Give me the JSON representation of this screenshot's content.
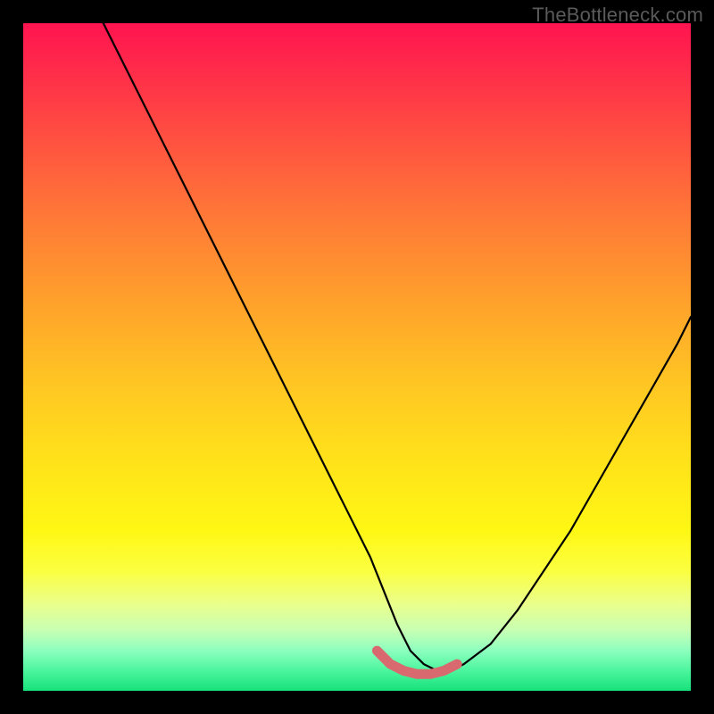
{
  "watermark": "TheBottleneck.com",
  "chart_data": {
    "type": "line",
    "title": "",
    "xlabel": "",
    "ylabel": "",
    "xlim": [
      0,
      100
    ],
    "ylim": [
      0,
      100
    ],
    "grid": false,
    "legend": false,
    "series": [
      {
        "name": "bottleneck-curve",
        "x": [
          12,
          16,
          20,
          24,
          28,
          32,
          36,
          40,
          44,
          48,
          52,
          54,
          56,
          58,
          60,
          62,
          64,
          66,
          70,
          74,
          78,
          82,
          86,
          90,
          94,
          98,
          100
        ],
        "values": [
          100,
          92,
          84,
          76,
          68,
          60,
          52,
          44,
          36,
          28,
          20,
          15,
          10,
          6,
          4,
          3,
          3,
          4,
          7,
          12,
          18,
          24,
          31,
          38,
          45,
          52,
          56
        ]
      },
      {
        "name": "optimal-band",
        "x": [
          53,
          55,
          57,
          59,
          61,
          63,
          65
        ],
        "values": [
          6,
          4,
          3,
          2.5,
          2.5,
          3,
          4
        ]
      }
    ],
    "colors": {
      "curve": "#000000",
      "optimal_band": "#d86a6f",
      "gradient_top": "#ff1450",
      "gradient_bottom": "#17e27a"
    }
  }
}
